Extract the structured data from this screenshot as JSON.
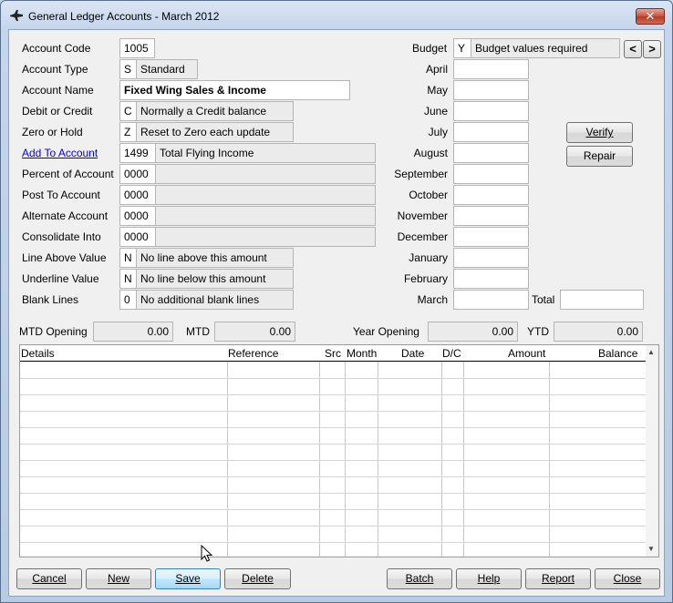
{
  "window": {
    "title": "General Ledger Accounts - March 2012",
    "close_label": "✕"
  },
  "left_fields": [
    {
      "label": "Account Code",
      "code": "1005",
      "desc": null
    },
    {
      "label": "Account Type",
      "code": "S",
      "desc": "Standard"
    },
    {
      "label": "Account Name",
      "code": null,
      "desc": "Fixed Wing Sales & Income"
    },
    {
      "label": "Debit or Credit",
      "code": "C",
      "desc": "Normally a Credit balance"
    },
    {
      "label": "Zero or Hold",
      "code": "Z",
      "desc": "Reset to Zero each update"
    },
    {
      "label": "Add To Account",
      "code": "1499",
      "desc": "Total Flying Income"
    },
    {
      "label": "Percent of Account",
      "code": "0000",
      "desc": ""
    },
    {
      "label": "Post To Account",
      "code": "0000",
      "desc": ""
    },
    {
      "label": "Alternate Account",
      "code": "0000",
      "desc": ""
    },
    {
      "label": "Consolidate Into",
      "code": "0000",
      "desc": ""
    },
    {
      "label": "Line Above Value",
      "code": "N",
      "desc": "No line above this amount"
    },
    {
      "label": "Underline Value",
      "code": "N",
      "desc": "No line below this amount"
    },
    {
      "label": "Blank Lines",
      "code": "0",
      "desc": "No additional blank lines"
    }
  ],
  "budget": {
    "label": "Budget",
    "code": "Y",
    "desc": "Budget values required",
    "prev_label": "<",
    "next_label": ">",
    "months": [
      "April",
      "May",
      "June",
      "July",
      "August",
      "September",
      "October",
      "November",
      "December",
      "January",
      "February",
      "March"
    ],
    "total_label": "Total",
    "total_value": ""
  },
  "side_buttons": {
    "verify": "Verify",
    "repair": "Repair"
  },
  "totals": {
    "mtd_opening_label": "MTD Opening",
    "mtd_opening": "0.00",
    "mtd_label": "MTD",
    "mtd": "0.00",
    "year_opening_label": "Year Opening",
    "year_opening": "0.00",
    "ytd_label": "YTD",
    "ytd": "0.00"
  },
  "grid": {
    "columns": [
      "Details",
      "Reference",
      "Src",
      "Month",
      "Date",
      "D/C",
      "Amount",
      "Balance"
    ],
    "rows": 12
  },
  "buttons": {
    "cancel": "Cancel",
    "new": "New",
    "save": "Save",
    "delete": "Delete",
    "batch": "Batch",
    "help": "Help",
    "report": "Report",
    "close": "Close"
  },
  "colors": {
    "link": "#0000ee",
    "hot_button": "#bee6fd",
    "close_button": "#c9503a"
  }
}
